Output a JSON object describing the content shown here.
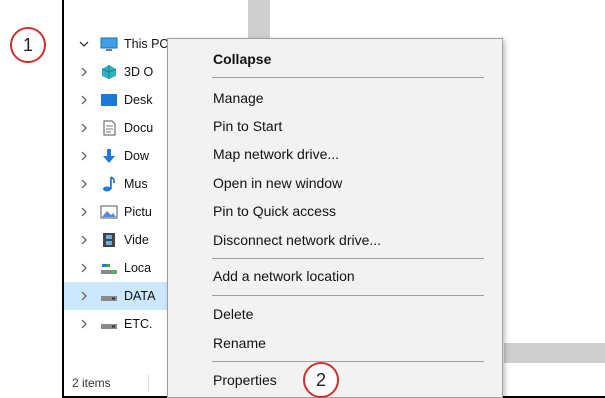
{
  "callouts": {
    "first": "1",
    "second": "2"
  },
  "tree": {
    "items": [
      {
        "label": "This PC",
        "icon": "computer-icon",
        "expanded": true
      },
      {
        "label": "3D O",
        "icon": "3d-objects-icon"
      },
      {
        "label": "Desk",
        "icon": "desktop-icon"
      },
      {
        "label": "Docu",
        "icon": "document-icon"
      },
      {
        "label": "Dow",
        "icon": "download-arrow-icon"
      },
      {
        "label": "Mus",
        "icon": "music-note-icon"
      },
      {
        "label": "Pictu",
        "icon": "pictures-icon"
      },
      {
        "label": "Vide",
        "icon": "video-film-icon"
      },
      {
        "label": "Loca",
        "icon": "local-disk-icon"
      },
      {
        "label": "DATA",
        "icon": "drive-icon",
        "selected": true
      },
      {
        "label": "ETC.",
        "icon": "drive-icon"
      }
    ]
  },
  "status": {
    "count": "2 items"
  },
  "context_menu": {
    "collapse": "Collapse",
    "manage": "Manage",
    "pin_start": "Pin to Start",
    "map_drive": "Map network drive...",
    "open_new": "Open in new window",
    "pin_quick": "Pin to Quick access",
    "disconnect": "Disconnect network drive...",
    "add_location": "Add a network location",
    "delete": "Delete",
    "rename": "Rename",
    "properties": "Properties"
  },
  "colors": {
    "selection": "#cce8ff",
    "callout_border": "#d32f2f",
    "menu_bg": "#f2f2f2"
  }
}
